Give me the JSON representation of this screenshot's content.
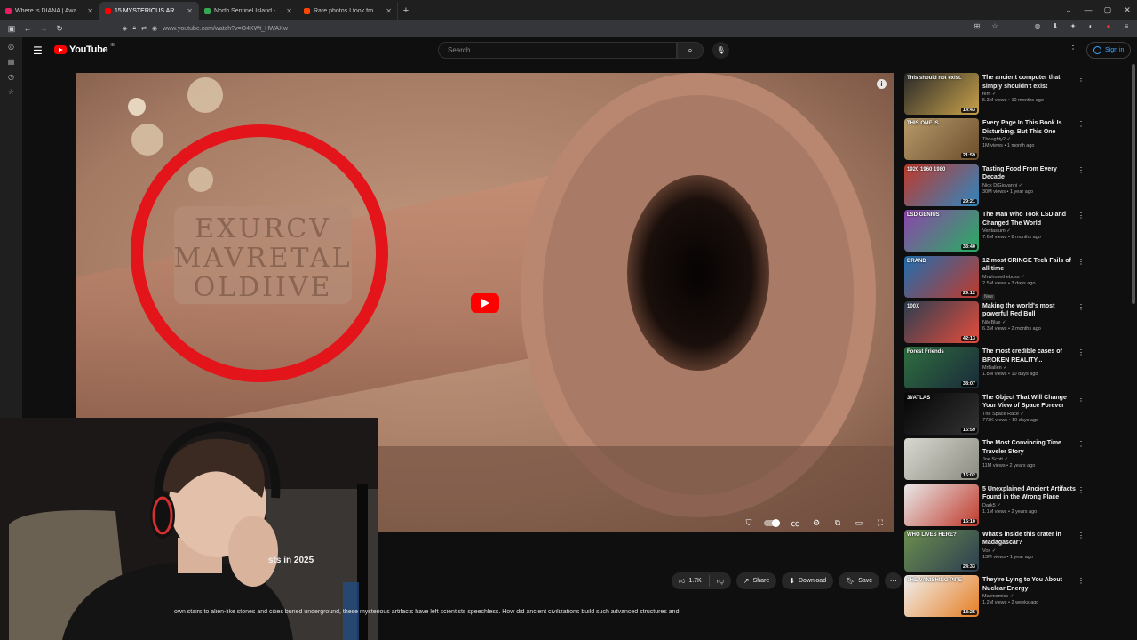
{
  "browser": {
    "tabs": [
      {
        "label": "Where is DIANA | Award-Winni",
        "color": "#e91e63",
        "active": false
      },
      {
        "label": "15 MYSTERIOUS ARTIFACTS Th",
        "color": "#ff0000",
        "active": true
      },
      {
        "label": "North Sentinel Island - Google",
        "color": "#34a853",
        "active": false
      },
      {
        "label": "Rare photos I took from the U",
        "color": "#ff4500",
        "active": false
      }
    ],
    "url": "www.youtube.com/watch?v=O4KWt_HWAXw"
  },
  "youtube": {
    "logo_text": "YouTube",
    "country_code": "IE",
    "search_placeholder": "Search",
    "signin_label": "Sign in"
  },
  "video": {
    "title_fragment": "sts in 2025",
    "actions": {
      "likes": "1.7K",
      "share": "Share",
      "download": "Download",
      "save": "Save"
    },
    "description": "own stairs to alien-like stones and cities buried underground, these mysterious artifacts have left scientists speechless. How did ancient civilizations build such advanced structures and"
  },
  "recommendations": [
    {
      "title": "The ancient computer that simply shouldn't exist",
      "channel": "fern",
      "stats": "5.3M views • 10 months ago",
      "duration": "14:43",
      "thumb_text": "This should not exist.",
      "colors": [
        "#2a2a2a",
        "#c9a24a"
      ]
    },
    {
      "title": "Every Page In This Book Is Disturbing. But This One Stand...",
      "channel": "Thoughty2",
      "stats": "1M views • 1 month ago",
      "duration": "21:59",
      "thumb_text": "THIS ONE IS",
      "colors": [
        "#b89a6a",
        "#6b4e2c"
      ]
    },
    {
      "title": "Tasting Food From Every Decade",
      "channel": "Nick DiGiovanni",
      "stats": "30M views • 1 year ago",
      "duration": "29:21",
      "thumb_text": "1920 1960 1980",
      "colors": [
        "#c0392b",
        "#2e86c1"
      ]
    },
    {
      "title": "The Man Who Took LSD and Changed The World",
      "channel": "Veritasium",
      "stats": "7.6M views • 8 months ago",
      "duration": "33:40",
      "thumb_text": "LSD GENIUS",
      "colors": [
        "#8e44ad",
        "#27ae60"
      ]
    },
    {
      "title": "12 most CRINGE Tech Fails of all time",
      "channel": "Mrwhosetheboss",
      "stats": "2.5M views • 3 days ago",
      "duration": "29:12",
      "thumb_text": "BRAND",
      "badge": "New",
      "colors": [
        "#1f6fb2",
        "#c0392b"
      ]
    },
    {
      "title": "Making the world's most powerful Red Bull",
      "channel": "NileBlue",
      "stats": "6.3M views • 2 months ago",
      "duration": "42:13",
      "thumb_text": "100X",
      "colors": [
        "#2c3e50",
        "#e74c3c"
      ]
    },
    {
      "title": "The most credible cases of BROKEN REALITY...",
      "channel": "MrBallen",
      "stats": "1.8M views • 10 days ago",
      "duration": "38:07",
      "thumb_text": "Forest Friends",
      "colors": [
        "#2f6f3f",
        "#1a2a3a"
      ]
    },
    {
      "title": "The Object That Will Change Your View of Space Forever",
      "channel": "The Space Race",
      "stats": "773K views • 10 days ago",
      "duration": "15:59",
      "thumb_text": "3I/ATLAS",
      "colors": [
        "#050505",
        "#333333"
      ]
    },
    {
      "title": "The Most Convincing Time Traveler Story",
      "channel": "Joe Scott",
      "stats": "11M views • 2 years ago",
      "duration": "16:02",
      "thumb_text": "",
      "colors": [
        "#d8d8d0",
        "#8a8a80"
      ]
    },
    {
      "title": "5 Unexplained Ancient Artifacts Found in the Wrong Place",
      "channel": "Dark5",
      "stats": "1.1M views • 2 years ago",
      "duration": "15:10",
      "thumb_text": "",
      "colors": [
        "#e8e8e8",
        "#c0392b"
      ]
    },
    {
      "title": "What's inside this crater in Madagascar?",
      "channel": "Vox",
      "stats": "13M views • 1 year ago",
      "duration": "24:33",
      "thumb_text": "WHO LIVES HERE?",
      "colors": [
        "#6b8e4e",
        "#2c3e50"
      ]
    },
    {
      "title": "They're Lying to You About Nuclear Energy",
      "channel": "Maxinomics",
      "stats": "1.2M views • 2 weeks ago",
      "duration": "18:25",
      "thumb_text": "THE VANISHING PIPE",
      "colors": [
        "#f0f0f0",
        "#e67e22"
      ]
    }
  ]
}
